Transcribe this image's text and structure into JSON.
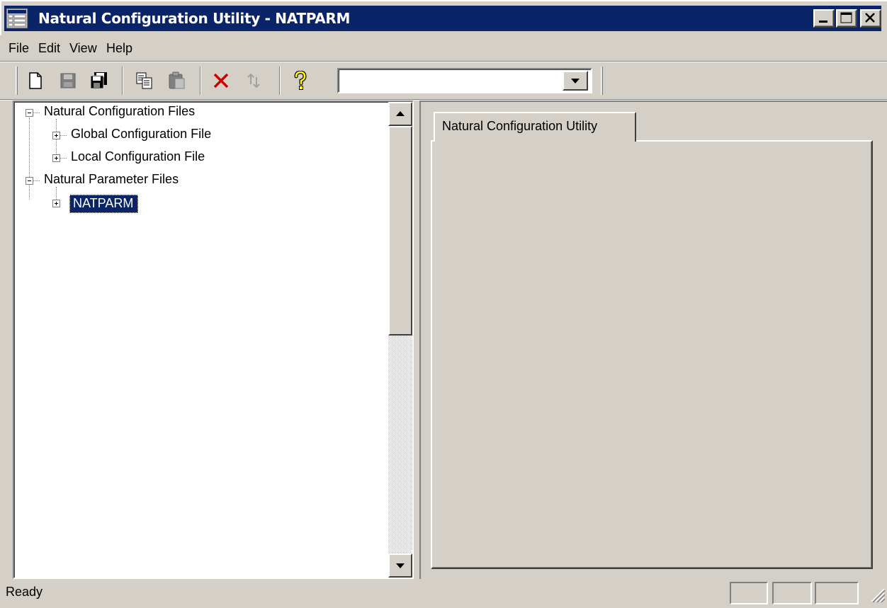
{
  "window": {
    "title": "Natural Configuration Utility - NATPARM"
  },
  "menu": {
    "items": [
      {
        "label": "File"
      },
      {
        "label": "Edit"
      },
      {
        "label": "View"
      },
      {
        "label": "Help"
      }
    ]
  },
  "toolbar": {
    "buttons": [
      "new-icon",
      "save-icon",
      "save-all-icon",
      "copy-icon",
      "paste-icon",
      "delete-icon",
      "refresh-icon",
      "help-icon"
    ],
    "combo": {
      "value": ""
    }
  },
  "tree": {
    "nodes": [
      {
        "label": "Natural Configuration Files",
        "expanded": true
      },
      {
        "label": "Global Configuration File",
        "expanded": false
      },
      {
        "label": "Local Configuration File",
        "expanded": false
      },
      {
        "label": "Natural Parameter Files",
        "expanded": true
      },
      {
        "label": "NATPARM",
        "expanded": false,
        "selected": true
      }
    ]
  },
  "tabs": [
    {
      "label": "Natural Configuration Utility"
    }
  ],
  "status": {
    "text": "Ready"
  },
  "colors": {
    "titlebar": "#0a246a",
    "selection": "#0a246a",
    "face": "#d4d0c8",
    "delete_icon": "#cc0000",
    "help_icon": "#ffff00"
  }
}
